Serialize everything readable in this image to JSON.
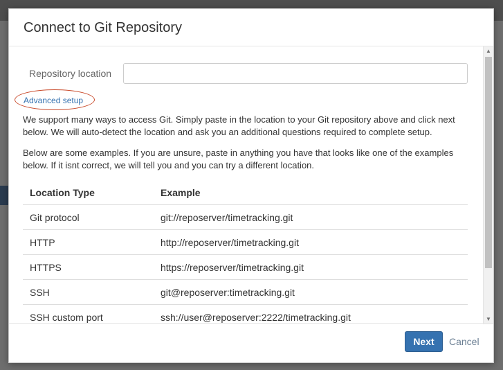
{
  "dialog": {
    "title": "Connect to Git Repository",
    "repo_label": "Repository location",
    "repo_value": "",
    "advanced_setup": "Advanced setup",
    "para1": "We support many ways to access Git. Simply paste in the location to your Git repository above and click next below. We will auto-detect the location and ask you an additional questions required to complete setup.",
    "para2": "Below are some examples. If you are unsure, paste in anything you have that looks like one of the examples below. If it isnt correct, we will tell you and you can try a different location.",
    "table": {
      "headers": [
        "Location Type",
        "Example"
      ],
      "rows": [
        [
          "Git protocol",
          "git://reposerver/timetracking.git"
        ],
        [
          "HTTP",
          "http://reposerver/timetracking.git"
        ],
        [
          "HTTPS",
          "https://reposerver/timetracking.git"
        ],
        [
          "SSH",
          "git@reposerver:timetracking.git"
        ],
        [
          "SSH custom port",
          "ssh://user@reposerver:2222/timetracking.git"
        ]
      ]
    },
    "next_label": "Next",
    "cancel_label": "Cancel"
  },
  "colors": {
    "primary": "#3572b0",
    "annotation": "#c94a2a"
  }
}
